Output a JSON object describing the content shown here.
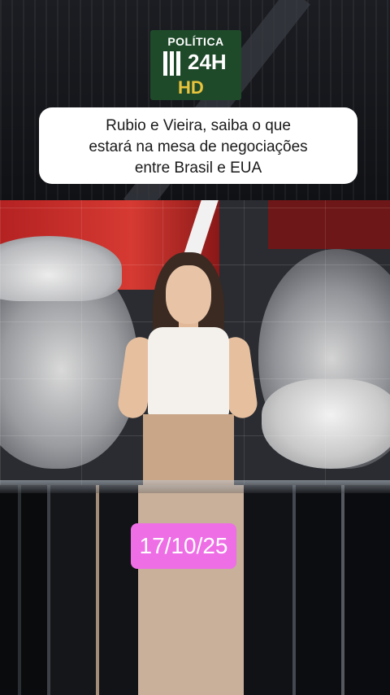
{
  "logo": {
    "title": "POLÍTICA",
    "channel": "24H",
    "quality": "HD",
    "colors": {
      "background": "#1f4a2a",
      "hd": "#e9c43c"
    }
  },
  "headline": {
    "lines": [
      "Rubio e Vieira, saiba o que",
      "estará na mesa de negociações",
      "entre Brasil e EUA"
    ]
  },
  "date_badge": {
    "text": "17/10/25",
    "color": "#ee6ee6"
  }
}
